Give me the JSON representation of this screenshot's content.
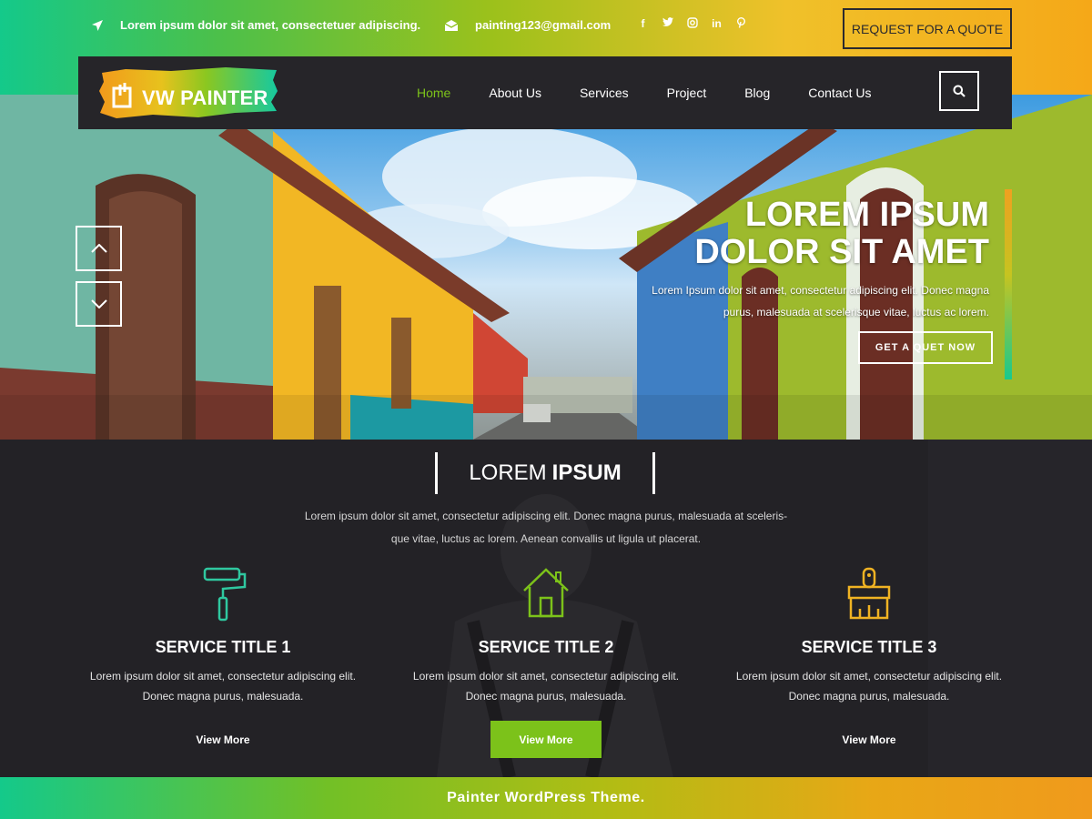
{
  "topbar": {
    "address": "Lorem ipsum dolor sit amet, consectetuer adipiscing.",
    "email": "painting123@gmail.com",
    "social": [
      "f",
      "t",
      "ig",
      "in",
      "p"
    ],
    "quote_button": "REQUEST FOR A QUOTE"
  },
  "brand": {
    "logo_text": "VW PAINTER"
  },
  "nav": {
    "items": [
      "Home",
      "About Us",
      "Services",
      "Project",
      "Blog",
      "Contact Us"
    ],
    "active": "Home"
  },
  "hero": {
    "title_line1": "LOREM IPSUM",
    "title_line2": "DOLOR SIT AMET",
    "text_line1": "Lorem Ipsum dolor sit amet, consectetur adipiscing elit. Donec magna",
    "text_line2": "purus, malesuada at scelerisque vitae, luctus ac lorem.",
    "button": "GET A QUET NOW"
  },
  "section": {
    "title_light": "LOREM",
    "title_bold": "IPSUM",
    "text_line1": "Lorem ipsum dolor sit amet, consectetur adipiscing elit. Donec magna purus, malesuada at sceleris-",
    "text_line2": "que vitae, luctus ac lorem. Aenean convallis ut ligula ut placerat."
  },
  "services": [
    {
      "title": "SERVICE TITLE 1",
      "text_line1": "Lorem ipsum dolor sit amet, consectetur adipiscing elit.",
      "text_line2": "Donec magna purus, malesuada.",
      "button": "View More",
      "icon": "paint-roller-icon"
    },
    {
      "title": "SERVICE TITLE 2",
      "text_line1": "Lorem ipsum dolor sit amet, consectetur adipiscing elit.",
      "text_line2": "Donec magna purus, malesuada.",
      "button": "View More",
      "icon": "house-icon"
    },
    {
      "title": "SERVICE TITLE 3",
      "text_line1": "Lorem ipsum dolor sit amet, consectetur adipiscing elit.",
      "text_line2": "Donec magna purus, malesuada.",
      "button": "View More",
      "icon": "paint-brush-icon"
    }
  ],
  "footer": {
    "text": "Painter WordPress Theme."
  },
  "colors": {
    "accent_green": "#7cc21a",
    "nav_dark": "#262529",
    "section_dark": "#232226",
    "gradient_start": "#14c98a",
    "gradient_end": "#f5a818"
  }
}
